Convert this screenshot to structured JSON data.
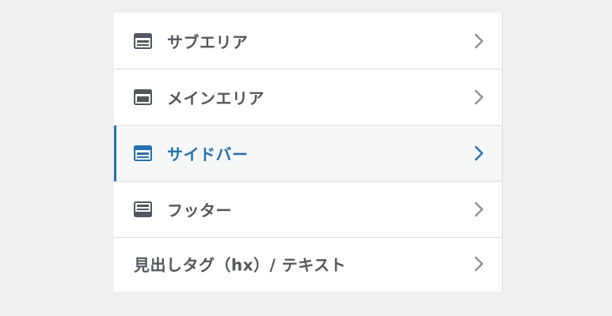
{
  "menu": {
    "items": [
      {
        "label": "サブエリア",
        "icon": "layout-sub-area-icon",
        "active": false
      },
      {
        "label": "メインエリア",
        "icon": "layout-main-area-icon",
        "active": false
      },
      {
        "label": "サイドバー",
        "icon": "layout-sidebar-icon",
        "active": true
      },
      {
        "label": "フッター",
        "icon": "layout-footer-icon",
        "active": false
      },
      {
        "label": "見出しタグ（hx）/ テキスト",
        "icon": null,
        "active": false
      }
    ]
  },
  "colors": {
    "page_background": "#f0f0f0",
    "panel_background": "#ffffff",
    "text": "#50575e",
    "icon": "#50575e",
    "chevron": "#8c8f94",
    "active_accent": "#2271b1",
    "active_background": "#f6f7f7",
    "divider": "#dcdcde"
  }
}
